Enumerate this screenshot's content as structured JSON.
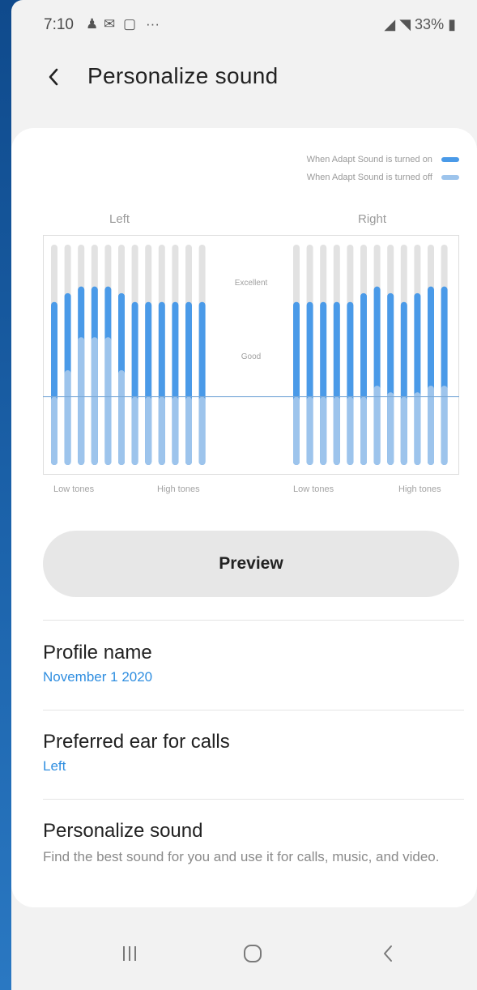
{
  "status_bar": {
    "time": "7:10",
    "icons": [
      "person-icon",
      "mail-icon",
      "message-icon",
      "more-icon"
    ],
    "more": "···",
    "battery": "33%"
  },
  "header": {
    "title": "Personalize sound"
  },
  "legend": {
    "items": [
      {
        "label": "When Adapt Sound is turned on",
        "color": "#4a9ae8"
      },
      {
        "label": "When Adapt Sound is turned off",
        "color": "#9dc4ec"
      }
    ]
  },
  "graph": {
    "left_label": "Left",
    "right_label": "Right",
    "mid_labels": [
      "Excellent",
      "Good"
    ],
    "low_tones": "Low tones",
    "high_tones": "High tones",
    "levels": {
      "note": "0 = bottom of graph, 1 = top; on = Adapt Sound on, off = off; baseline = reference line",
      "baseline": 0.31,
      "left": {
        "on": [
          0.74,
          0.78,
          0.81,
          0.81,
          0.81,
          0.78,
          0.74,
          0.74,
          0.74,
          0.74,
          0.74,
          0.74
        ],
        "off": [
          0.31,
          0.43,
          0.58,
          0.58,
          0.58,
          0.43,
          0.31,
          0.31,
          0.31,
          0.31,
          0.31,
          0.31
        ]
      },
      "right": {
        "on": [
          0.74,
          0.74,
          0.74,
          0.74,
          0.74,
          0.78,
          0.81,
          0.78,
          0.74,
          0.78,
          0.81,
          0.81
        ],
        "off": [
          0.31,
          0.31,
          0.31,
          0.31,
          0.31,
          0.31,
          0.36,
          0.33,
          0.31,
          0.33,
          0.36,
          0.36
        ]
      }
    }
  },
  "preview_label": "Preview",
  "settings": [
    {
      "title": "Profile name",
      "value": "November 1 2020"
    },
    {
      "title": "Preferred ear for calls",
      "value": "Left"
    },
    {
      "title": "Personalize sound",
      "description": "Find the best sound for you and use it for calls, music, and video."
    }
  ],
  "nav": {
    "recents": "recents-icon",
    "home": "home-icon",
    "back": "back-icon"
  },
  "colors": {
    "accent": "#2f8ee0",
    "bar_on": "#4a9ae8",
    "bar_off": "#9dc4ec",
    "bar_track": "#e2e2e2"
  }
}
